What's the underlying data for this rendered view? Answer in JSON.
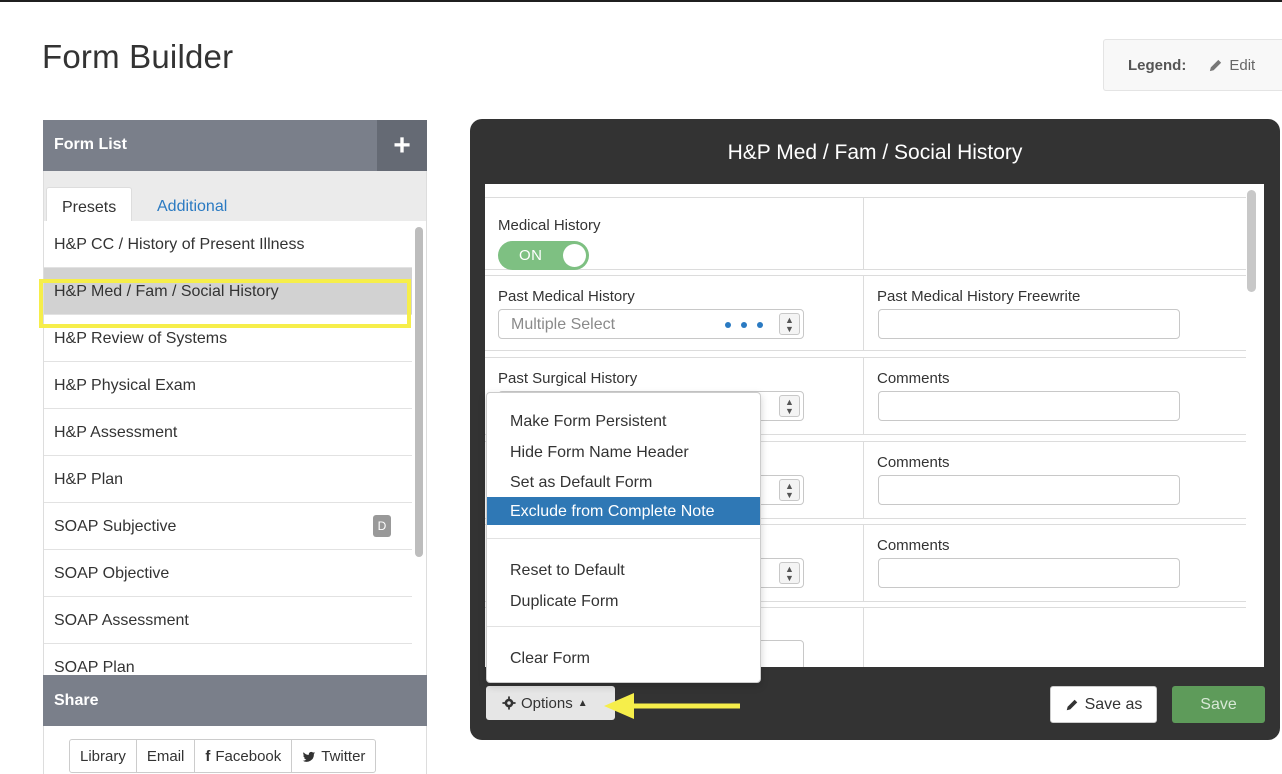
{
  "page": {
    "title": "Form Builder"
  },
  "legend": {
    "label": "Legend:",
    "edit_label": "Edit"
  },
  "sidebar": {
    "title": "Form List",
    "add_symbol": "+",
    "tabs": [
      {
        "label": "Presets",
        "active": true
      },
      {
        "label": "Additional",
        "active": false
      }
    ],
    "items": [
      {
        "label": "H&P CC / History of Present Illness"
      },
      {
        "label": "H&P Med / Fam / Social History",
        "selected": true
      },
      {
        "label": "H&P Review of Systems"
      },
      {
        "label": "H&P Physical Exam"
      },
      {
        "label": "H&P Assessment"
      },
      {
        "label": "H&P Plan"
      },
      {
        "label": "SOAP Subjective",
        "badge": "D"
      },
      {
        "label": "SOAP Objective"
      },
      {
        "label": "SOAP Assessment"
      },
      {
        "label": "SOAP Plan"
      }
    ]
  },
  "share": {
    "title": "Share",
    "buttons": [
      {
        "label": "Library",
        "icon": ""
      },
      {
        "label": "Email",
        "icon": ""
      },
      {
        "label": "Facebook",
        "icon": "f"
      },
      {
        "label": "Twitter",
        "icon": "🐦"
      }
    ]
  },
  "form": {
    "title": "H&P Med / Fam / Social History",
    "medical_history": {
      "label": "Medical History",
      "toggle": "ON"
    },
    "past_medical": {
      "label": "Past Medical History",
      "placeholder": "Multiple Select",
      "freewrite_label": "Past Medical History Freewrite"
    },
    "past_surgical": {
      "label": "Past Surgical History",
      "comments_label": "Comments"
    },
    "row4": {
      "comments_label": "Comments"
    },
    "row5": {
      "comments_label": "Comments"
    }
  },
  "footer": {
    "options_label": "Options",
    "save_as_label": "Save as",
    "save_label": "Save"
  },
  "menu": {
    "items": [
      {
        "label": "Make Form Persistent"
      },
      {
        "label": "Hide Form Name Header"
      },
      {
        "label": "Set as Default Form"
      },
      {
        "label": "Exclude from Complete Note",
        "active": true
      },
      {
        "label": "Reset to Default"
      },
      {
        "label": "Duplicate Form"
      },
      {
        "label": "Clear Form"
      }
    ]
  },
  "colors": {
    "accent_blue": "#2f78b5",
    "highlight_yellow": "#f6ee4a",
    "toggle_green": "#7ec082",
    "save_green": "#5e9b5a",
    "panel_dark": "#333333",
    "header_gray": "#7a7f8a"
  }
}
